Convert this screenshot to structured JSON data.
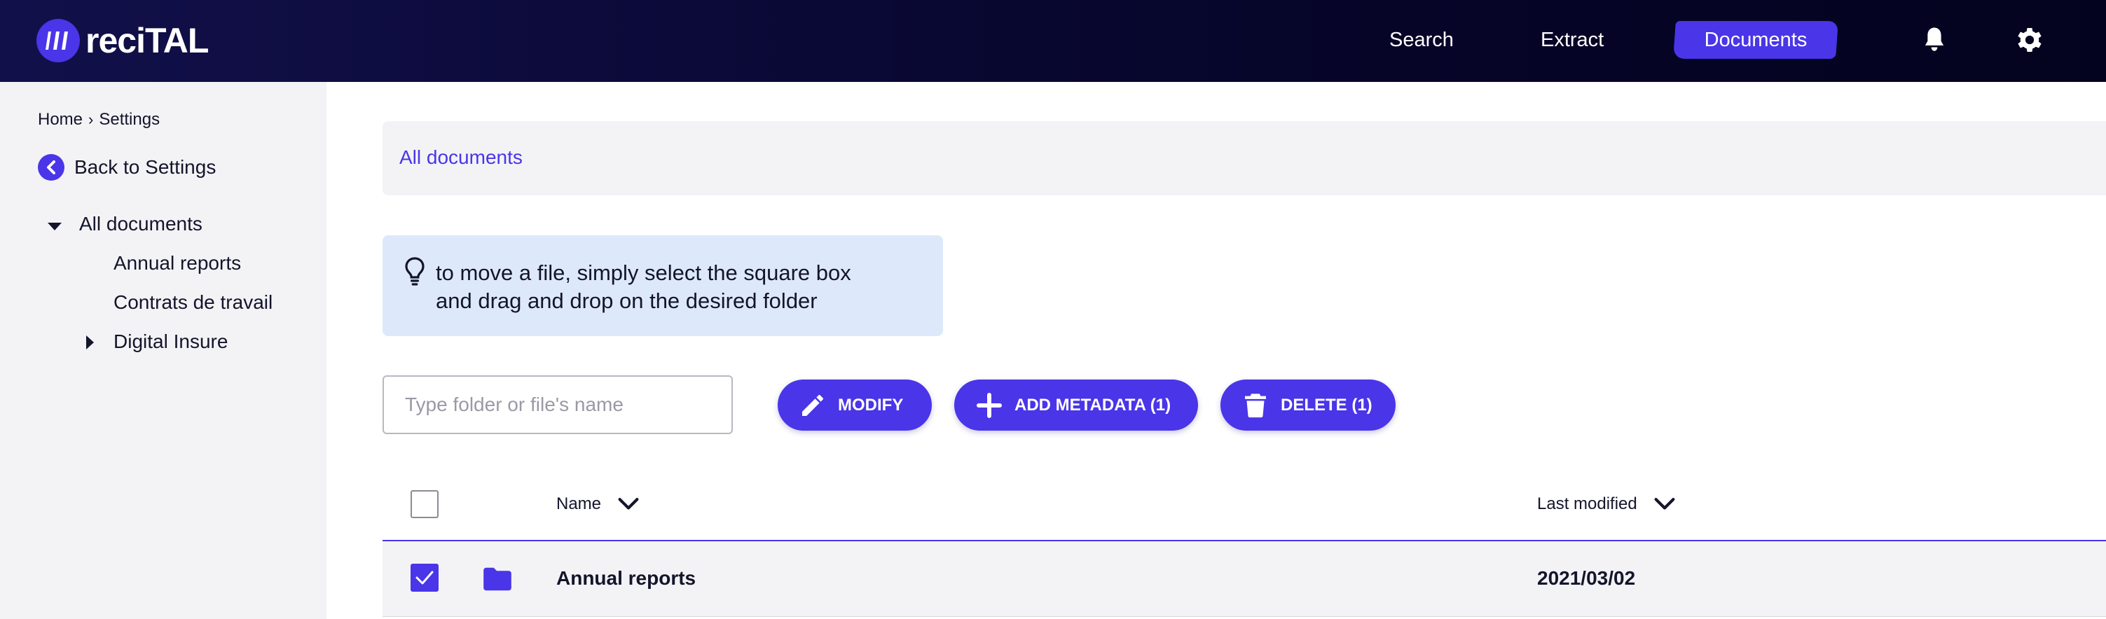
{
  "header": {
    "logo_text": "reciTAL",
    "nav": {
      "search": "Search",
      "extract": "Extract",
      "documents": "Documents"
    },
    "icons": [
      "bell-icon",
      "gear-icon"
    ]
  },
  "sidebar": {
    "breadcrumb": {
      "home": "Home",
      "separator": "›",
      "settings": "Settings"
    },
    "back_label": "Back to Settings",
    "tree": {
      "root": "All documents",
      "children": [
        "Annual reports",
        "Contrats de travail",
        "Digital Insure"
      ]
    }
  },
  "main": {
    "breadcrumb": "All documents",
    "tip": {
      "line1": "to move a file, simply select the square box",
      "line2": "and drag and drop on the desired folder"
    },
    "search": {
      "placeholder": "Type folder or file's name",
      "value": ""
    },
    "buttons": {
      "modify": "MODIFY",
      "add_metadata": "ADD METADATA (1)",
      "delete": "DELETE (1)"
    },
    "table": {
      "columns": {
        "name": "Name",
        "last_modified": "Last modified"
      },
      "rows": [
        {
          "name": "Annual reports",
          "last_modified": "2021/03/02",
          "selected": true,
          "type": "folder"
        }
      ]
    }
  },
  "colors": {
    "accent": "#4a35e8",
    "header_bg": "#06052a",
    "sidebar_bg": "#f3f3f6",
    "tip_bg": "#dde9fb"
  }
}
